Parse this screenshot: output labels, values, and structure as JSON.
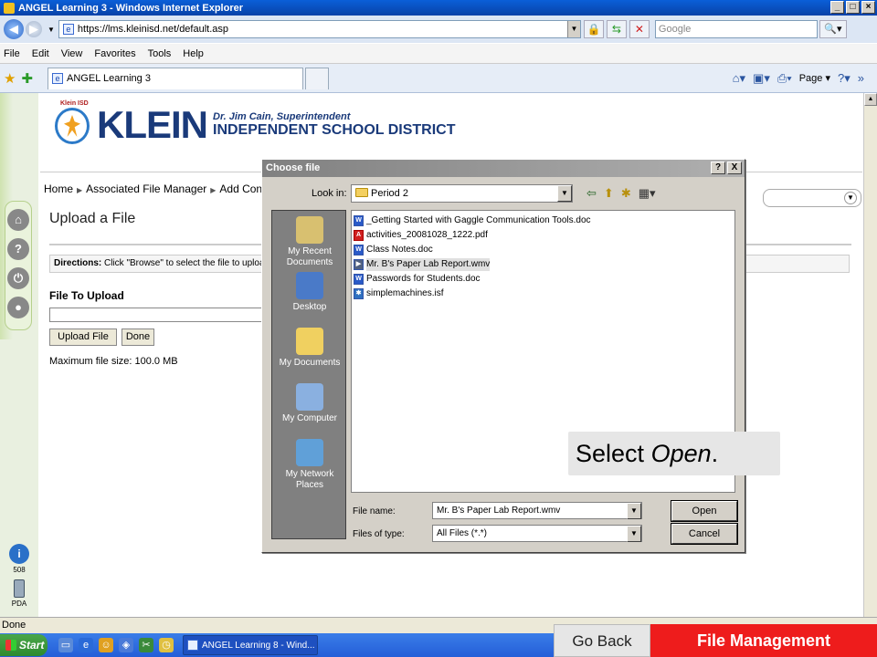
{
  "window": {
    "title": "ANGEL Learning 3 - Windows Internet Explorer",
    "controls": [
      "_",
      "□",
      "×"
    ]
  },
  "browser": {
    "address": "https://lms.kleinisd.net/default.asp",
    "search_placeholder": "Google",
    "menu": [
      "File",
      "Edit",
      "View",
      "Favorites",
      "Tools",
      "Help"
    ],
    "tab_title": "ANGEL Learning 3",
    "page_menu": "Page",
    "status": "Done"
  },
  "site": {
    "logo_tag": "Klein ISD",
    "logo_text": "KLEIN",
    "superintendent": "Dr. Jim Cain, Superintendent",
    "district": "INDEPENDENT SCHOOL DISTRICT",
    "breadcrumbs": [
      "Home",
      "Associated File Manager",
      "Add Conte"
    ],
    "page_title": "Upload a File",
    "directions_label": "Directions:",
    "directions_text": "Click \"Browse\" to select the file to upload",
    "file_to_upload": "File To Upload",
    "upload_button": "Upload File",
    "done_button": "Done",
    "max_size": "Maximum file size: 100.0 MB",
    "badge_508": "508",
    "pda": "PDA"
  },
  "dialog": {
    "title": "Choose file",
    "title_buttons": [
      "?",
      "X"
    ],
    "look_in_label": "Look in:",
    "look_in_value": "Period 2",
    "places": [
      {
        "label": "My Recent Documents",
        "icon": "recent-documents-icon",
        "color": "#d8c070"
      },
      {
        "label": "Desktop",
        "icon": "desktop-icon",
        "color": "#4a7ac8"
      },
      {
        "label": "My Documents",
        "icon": "my-documents-icon",
        "color": "#f0d060"
      },
      {
        "label": "My Computer",
        "icon": "my-computer-icon",
        "color": "#8ab0e0"
      },
      {
        "label": "My Network Places",
        "icon": "network-places-icon",
        "color": "#60a0d8"
      }
    ],
    "files": [
      {
        "name": "_Getting Started with Gaggle Communication Tools.doc",
        "icon": "word-doc-icon",
        "color": "#2a5ac8",
        "selected": false
      },
      {
        "name": "activities_20081028_1222.pdf",
        "icon": "pdf-icon",
        "color": "#d02020",
        "selected": false
      },
      {
        "name": "Class Notes.doc",
        "icon": "word-doc-icon",
        "color": "#2a5ac8",
        "selected": false
      },
      {
        "name": "Mr. B's Paper Lab Report.wmv",
        "icon": "video-file-icon",
        "color": "#506080",
        "selected": true
      },
      {
        "name": "Passwords for Students.doc",
        "icon": "word-doc-icon",
        "color": "#2a5ac8",
        "selected": false
      },
      {
        "name": "simplemachines.isf",
        "icon": "isf-file-icon",
        "color": "#3070c0",
        "selected": false
      }
    ],
    "file_name_label": "File name:",
    "file_name_value": "Mr. B's Paper Lab Report.wmv",
    "files_of_type_label": "Files of type:",
    "files_of_type_value": "All Files (*.*)",
    "open_button": "Open",
    "cancel_button": "Cancel"
  },
  "callout": {
    "prefix": "Select",
    "emphasis": "Open",
    "suffix": "."
  },
  "taskbar": {
    "start": "Start",
    "task": "ANGEL Learning 8 - Wind..."
  },
  "slide_nav": {
    "go_back": "Go Back",
    "section": "File Management"
  }
}
